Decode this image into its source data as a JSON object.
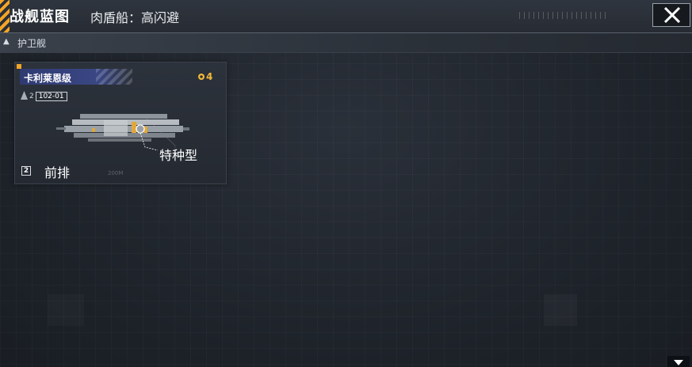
{
  "header": {
    "title": "战舰蓝图",
    "subtitle": "肉盾船：高闪避",
    "close_icon": "close-icon"
  },
  "section": {
    "arrow": "▲",
    "label": "护卫舰"
  },
  "cards": [
    {
      "name": "卡利莱恩级",
      "cost": "4",
      "tier": "2",
      "model": "102-01",
      "type": "特种型",
      "row_index": "2",
      "row": "前排",
      "scale": "200M"
    }
  ],
  "colors": {
    "accent": "#f3a526",
    "name_band": "#2f3a72",
    "background": "#1f242c"
  }
}
